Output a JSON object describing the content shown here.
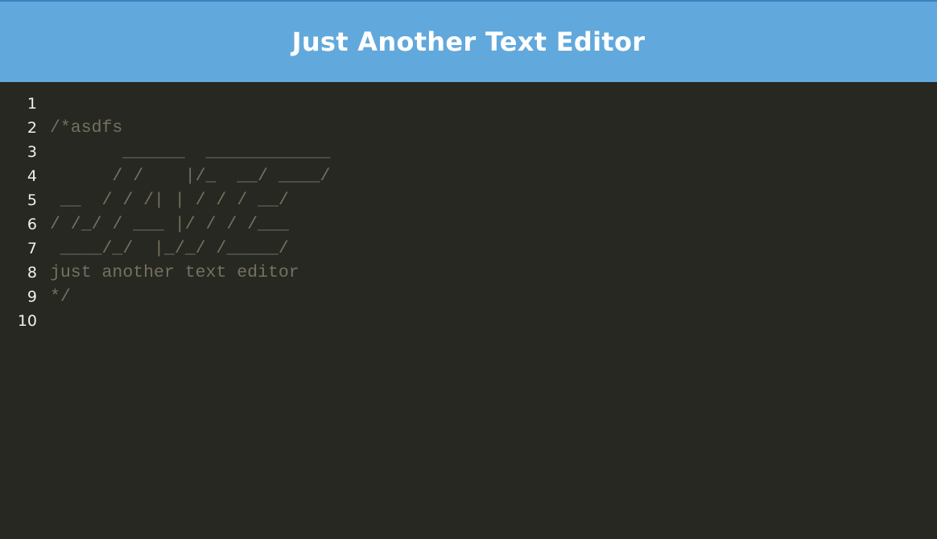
{
  "app": {
    "title": "Just Another Text Editor"
  },
  "editor": {
    "lines": [
      {
        "number": "1",
        "text": ""
      },
      {
        "number": "2",
        "text": "/*asdfs"
      },
      {
        "number": "3",
        "text": "       ______  ____________"
      },
      {
        "number": "4",
        "text": "      / /    |/_  __/ ____/"
      },
      {
        "number": "5",
        "text": " __  / / /| | / / / __/"
      },
      {
        "number": "6",
        "text": "/ /_/ / ___ |/ / / /___"
      },
      {
        "number": "7",
        "text": " ____/_/  |_/_/ /_____/"
      },
      {
        "number": "8",
        "text": "just another text editor"
      },
      {
        "number": "9",
        "text": "*/"
      },
      {
        "number": "10",
        "text": ""
      }
    ]
  },
  "colors": {
    "header_bg": "#61a8dc",
    "editor_bg": "#272822",
    "comment": "#75715e",
    "gutter_text": "#f0f0f0"
  }
}
